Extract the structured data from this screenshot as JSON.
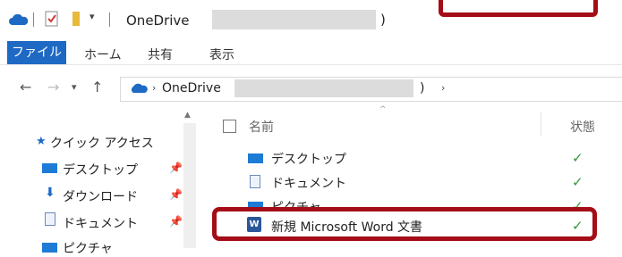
{
  "titlebar": {
    "title": "OneDrive",
    "title_suffix": ")"
  },
  "ribbon": {
    "tabs": [
      "ファイル",
      "ホーム",
      "共有",
      "表示"
    ]
  },
  "address": {
    "root": "OneDrive",
    "suffix": ")"
  },
  "navpane": {
    "quick_access": "クイック アクセス",
    "items": [
      "デスクトップ",
      "ダウンロード",
      "ドキュメント",
      "ピクチャ"
    ]
  },
  "list": {
    "col_name": "名前",
    "col_status": "状態",
    "items": [
      {
        "name": "デスクトップ",
        "icon": "folder-icon",
        "status": "✓"
      },
      {
        "name": "ドキュメント",
        "icon": "document-folder-icon",
        "status": "✓"
      },
      {
        "name": "ピクチャ",
        "icon": "pictures-folder-icon",
        "status": "✓"
      },
      {
        "name": "新規 Microsoft Word 文書",
        "icon": "word-document-icon",
        "status": "✓"
      }
    ]
  },
  "colors": {
    "ribbon_file_tab": "#1d69c4",
    "highlight_box": "#a50d16",
    "status_ok": "#2e9a36"
  }
}
